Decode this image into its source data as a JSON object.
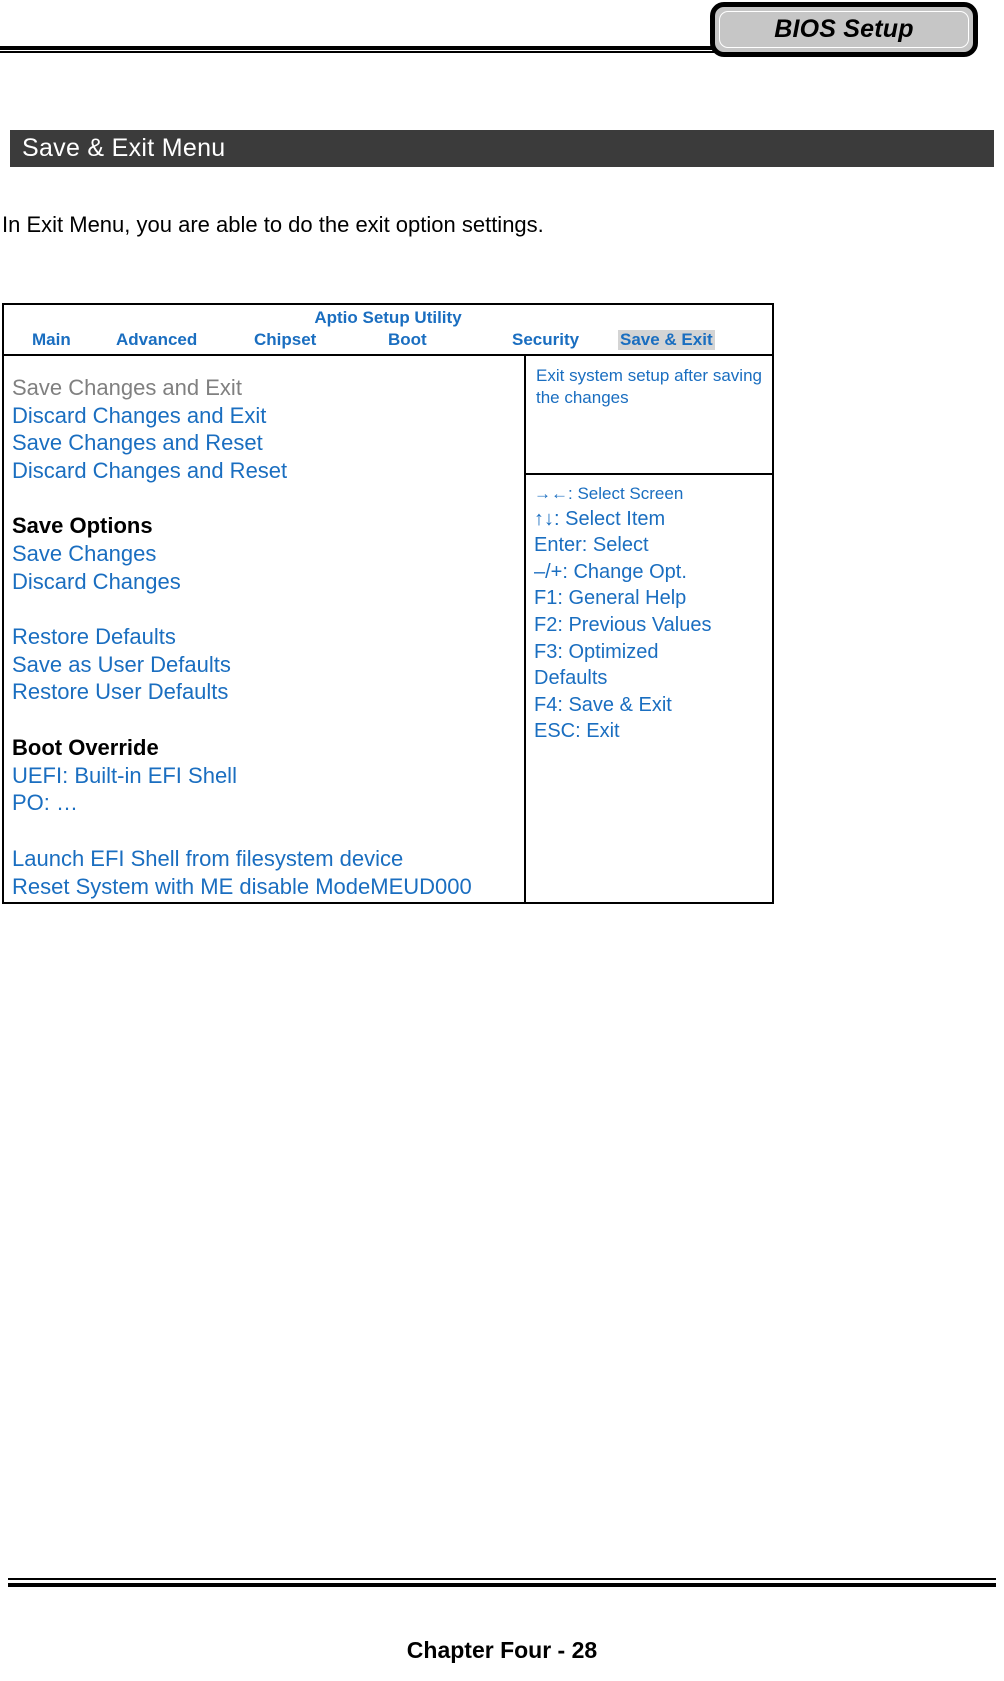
{
  "header": {
    "badge_label": "BIOS Setup"
  },
  "section": {
    "title": "Save & Exit Menu"
  },
  "intro": {
    "text": "In Exit Menu, you are able to do the exit option settings."
  },
  "bios": {
    "utility_title": "Aptio Setup Utility",
    "tabs": [
      {
        "label": "Main",
        "active": false
      },
      {
        "label": "Advanced",
        "active": false
      },
      {
        "label": "Chipset",
        "active": false
      },
      {
        "label": "Boot",
        "active": false
      },
      {
        "label": "Security",
        "active": false
      },
      {
        "label": "Save & Exit",
        "active": true
      }
    ],
    "menu_items": [
      {
        "label": "Save Changes and Exit",
        "style": "selected"
      },
      {
        "label": "Discard Changes and Exit",
        "style": "normal"
      },
      {
        "label": "Save Changes and Reset",
        "style": "normal"
      },
      {
        "label": "Discard Changes and Reset",
        "style": "normal"
      },
      {
        "label": "",
        "style": "spacer"
      },
      {
        "label": "Save Options",
        "style": "group"
      },
      {
        "label": "Save Changes",
        "style": "normal"
      },
      {
        "label": "Discard Changes",
        "style": "normal"
      },
      {
        "label": "",
        "style": "spacer"
      },
      {
        "label": "Restore Defaults",
        "style": "normal"
      },
      {
        "label": "Save as User Defaults",
        "style": "normal"
      },
      {
        "label": "Restore User Defaults",
        "style": "normal"
      },
      {
        "label": "",
        "style": "spacer"
      },
      {
        "label": "Boot Override",
        "style": "group"
      },
      {
        "label": "UEFI: Built-in EFI Shell",
        "style": "normal"
      },
      {
        "label": "PO: …",
        "style": "normal"
      },
      {
        "label": "",
        "style": "spacer"
      },
      {
        "label": "Launch EFI Shell from filesystem device",
        "style": "normal"
      },
      {
        "label": "Reset System with ME disable ModeMEUD000",
        "style": "normal"
      }
    ],
    "help_text": "Exit system setup after saving the changes",
    "key_legend": [
      {
        "label": "→←: Select Screen",
        "small": true
      },
      {
        "label": "↑↓: Select Item",
        "small": false
      },
      {
        "label": "Enter: Select",
        "small": false
      },
      {
        "label": "–/+: Change Opt.",
        "small": false
      },
      {
        "label": "F1: General Help",
        "small": false
      },
      {
        "label": "F2: Previous Values",
        "small": false
      },
      {
        "label": "F3: Optimized",
        "small": false
      },
      {
        "label": "Defaults",
        "small": false
      },
      {
        "label": "F4: Save & Exit",
        "small": false
      },
      {
        "label": "ESC: Exit",
        "small": false
      }
    ]
  },
  "footer": {
    "text": "Chapter Four - 28"
  },
  "colors": {
    "bios_blue": "#1a6ec0",
    "selected_gray": "#808080",
    "band_dark": "#3b3b3b",
    "tab_gray": "#c6c6c6",
    "active_tab_bg": "#d4d4d4"
  }
}
